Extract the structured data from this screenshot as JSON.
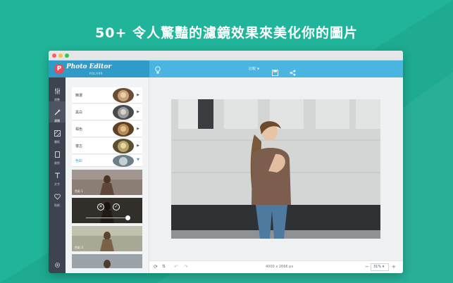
{
  "headline": "50+ 令人驚豔的濾鏡效果來美化你的圖片",
  "app": {
    "logo_letter": "P",
    "logo_name": "Photo Editor",
    "logo_sub": "POLARR"
  },
  "toolbar": {
    "compare_label": "比較",
    "icons": [
      "lightbulb-icon",
      "save-icon",
      "share-icon"
    ]
  },
  "leftnav": {
    "items": [
      {
        "label": "調整",
        "icon": "sliders-icon"
      },
      {
        "label": "濾鏡",
        "icon": "wand-icon",
        "active": true
      },
      {
        "label": "畫框",
        "icon": "frame-icon"
      },
      {
        "label": "裁剪",
        "icon": "crop-icon"
      },
      {
        "label": "文字",
        "icon": "text-icon"
      },
      {
        "label": "貼紙",
        "icon": "heart-icon"
      }
    ],
    "settings_icon": "gear-icon"
  },
  "filters": {
    "categories": [
      {
        "name": "精選"
      },
      {
        "name": "黑白"
      },
      {
        "name": "褐色"
      },
      {
        "name": "復古"
      },
      {
        "name": "色彩",
        "selected": true
      }
    ],
    "presets": [
      {
        "label": "色彩 1"
      },
      {
        "label": "色彩 2",
        "editing": true
      },
      {
        "label": "色彩 3"
      },
      {
        "label": "色彩 4"
      }
    ]
  },
  "status": {
    "dimensions": "4000 x 2666 px",
    "zoom": "31%",
    "zoom_minus": "−",
    "zoom_plus": "+"
  },
  "colors": {
    "background": "#20b59a",
    "appbar": "#4ab5e0",
    "sidebar": "#3d4450",
    "accent": "#3b9fd6"
  }
}
